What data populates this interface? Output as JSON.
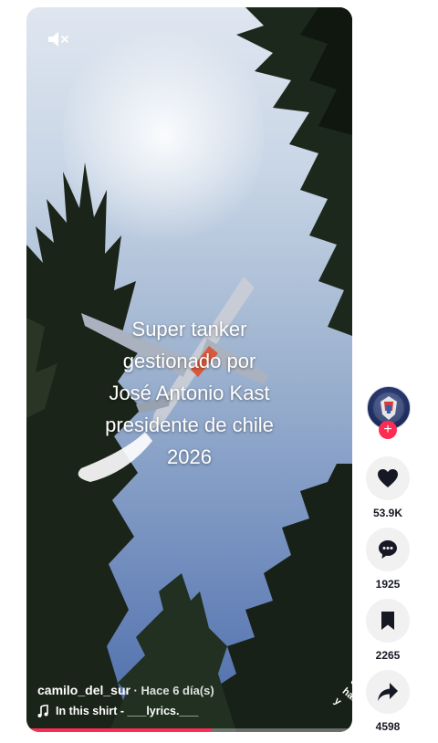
{
  "video": {
    "caption_lines": [
      "Super tanker",
      "gestionado por",
      "José Antonio Kast",
      "presidente de chile",
      "2026"
    ],
    "username": "camilo_del_sur",
    "time_separator": " · ",
    "posted": "Hace 6 día(s)",
    "music": "In this shirt - ___lyrics.___",
    "progress_percent": 57,
    "side_text_lines": [
      "qu",
      "has",
      "y"
    ]
  },
  "actions": {
    "likes": "53.9K",
    "comments": "1925",
    "saves": "2265",
    "shares": "4598"
  },
  "follow": {
    "label": "+"
  },
  "colors": {
    "accent": "#fe2c55",
    "button_bg": "#f1f1f2",
    "text": "#161823"
  },
  "icons": [
    "mute-icon",
    "music-note-icon",
    "heart-icon",
    "comment-icon",
    "bookmark-icon",
    "share-icon"
  ]
}
